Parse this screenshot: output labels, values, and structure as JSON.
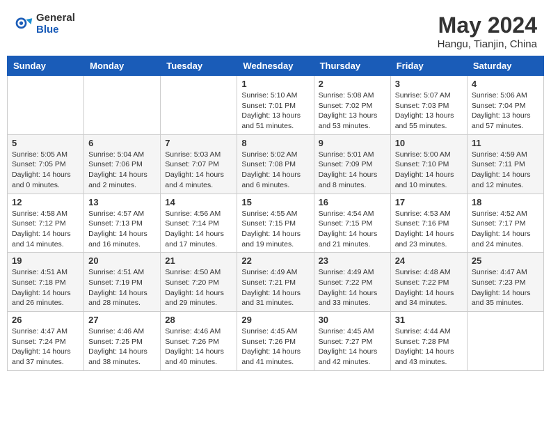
{
  "logo": {
    "general": "General",
    "blue": "Blue"
  },
  "title": "May 2024",
  "subtitle": "Hangu, Tianjin, China",
  "days_header": [
    "Sunday",
    "Monday",
    "Tuesday",
    "Wednesday",
    "Thursday",
    "Friday",
    "Saturday"
  ],
  "weeks": [
    [
      {
        "day": "",
        "info": ""
      },
      {
        "day": "",
        "info": ""
      },
      {
        "day": "",
        "info": ""
      },
      {
        "day": "1",
        "info": "Sunrise: 5:10 AM\nSunset: 7:01 PM\nDaylight: 13 hours\nand 51 minutes."
      },
      {
        "day": "2",
        "info": "Sunrise: 5:08 AM\nSunset: 7:02 PM\nDaylight: 13 hours\nand 53 minutes."
      },
      {
        "day": "3",
        "info": "Sunrise: 5:07 AM\nSunset: 7:03 PM\nDaylight: 13 hours\nand 55 minutes."
      },
      {
        "day": "4",
        "info": "Sunrise: 5:06 AM\nSunset: 7:04 PM\nDaylight: 13 hours\nand 57 minutes."
      }
    ],
    [
      {
        "day": "5",
        "info": "Sunrise: 5:05 AM\nSunset: 7:05 PM\nDaylight: 14 hours\nand 0 minutes."
      },
      {
        "day": "6",
        "info": "Sunrise: 5:04 AM\nSunset: 7:06 PM\nDaylight: 14 hours\nand 2 minutes."
      },
      {
        "day": "7",
        "info": "Sunrise: 5:03 AM\nSunset: 7:07 PM\nDaylight: 14 hours\nand 4 minutes."
      },
      {
        "day": "8",
        "info": "Sunrise: 5:02 AM\nSunset: 7:08 PM\nDaylight: 14 hours\nand 6 minutes."
      },
      {
        "day": "9",
        "info": "Sunrise: 5:01 AM\nSunset: 7:09 PM\nDaylight: 14 hours\nand 8 minutes."
      },
      {
        "day": "10",
        "info": "Sunrise: 5:00 AM\nSunset: 7:10 PM\nDaylight: 14 hours\nand 10 minutes."
      },
      {
        "day": "11",
        "info": "Sunrise: 4:59 AM\nSunset: 7:11 PM\nDaylight: 14 hours\nand 12 minutes."
      }
    ],
    [
      {
        "day": "12",
        "info": "Sunrise: 4:58 AM\nSunset: 7:12 PM\nDaylight: 14 hours\nand 14 minutes."
      },
      {
        "day": "13",
        "info": "Sunrise: 4:57 AM\nSunset: 7:13 PM\nDaylight: 14 hours\nand 16 minutes."
      },
      {
        "day": "14",
        "info": "Sunrise: 4:56 AM\nSunset: 7:14 PM\nDaylight: 14 hours\nand 17 minutes."
      },
      {
        "day": "15",
        "info": "Sunrise: 4:55 AM\nSunset: 7:15 PM\nDaylight: 14 hours\nand 19 minutes."
      },
      {
        "day": "16",
        "info": "Sunrise: 4:54 AM\nSunset: 7:15 PM\nDaylight: 14 hours\nand 21 minutes."
      },
      {
        "day": "17",
        "info": "Sunrise: 4:53 AM\nSunset: 7:16 PM\nDaylight: 14 hours\nand 23 minutes."
      },
      {
        "day": "18",
        "info": "Sunrise: 4:52 AM\nSunset: 7:17 PM\nDaylight: 14 hours\nand 24 minutes."
      }
    ],
    [
      {
        "day": "19",
        "info": "Sunrise: 4:51 AM\nSunset: 7:18 PM\nDaylight: 14 hours\nand 26 minutes."
      },
      {
        "day": "20",
        "info": "Sunrise: 4:51 AM\nSunset: 7:19 PM\nDaylight: 14 hours\nand 28 minutes."
      },
      {
        "day": "21",
        "info": "Sunrise: 4:50 AM\nSunset: 7:20 PM\nDaylight: 14 hours\nand 29 minutes."
      },
      {
        "day": "22",
        "info": "Sunrise: 4:49 AM\nSunset: 7:21 PM\nDaylight: 14 hours\nand 31 minutes."
      },
      {
        "day": "23",
        "info": "Sunrise: 4:49 AM\nSunset: 7:22 PM\nDaylight: 14 hours\nand 33 minutes."
      },
      {
        "day": "24",
        "info": "Sunrise: 4:48 AM\nSunset: 7:22 PM\nDaylight: 14 hours\nand 34 minutes."
      },
      {
        "day": "25",
        "info": "Sunrise: 4:47 AM\nSunset: 7:23 PM\nDaylight: 14 hours\nand 35 minutes."
      }
    ],
    [
      {
        "day": "26",
        "info": "Sunrise: 4:47 AM\nSunset: 7:24 PM\nDaylight: 14 hours\nand 37 minutes."
      },
      {
        "day": "27",
        "info": "Sunrise: 4:46 AM\nSunset: 7:25 PM\nDaylight: 14 hours\nand 38 minutes."
      },
      {
        "day": "28",
        "info": "Sunrise: 4:46 AM\nSunset: 7:26 PM\nDaylight: 14 hours\nand 40 minutes."
      },
      {
        "day": "29",
        "info": "Sunrise: 4:45 AM\nSunset: 7:26 PM\nDaylight: 14 hours\nand 41 minutes."
      },
      {
        "day": "30",
        "info": "Sunrise: 4:45 AM\nSunset: 7:27 PM\nDaylight: 14 hours\nand 42 minutes."
      },
      {
        "day": "31",
        "info": "Sunrise: 4:44 AM\nSunset: 7:28 PM\nDaylight: 14 hours\nand 43 minutes."
      },
      {
        "day": "",
        "info": ""
      }
    ]
  ]
}
